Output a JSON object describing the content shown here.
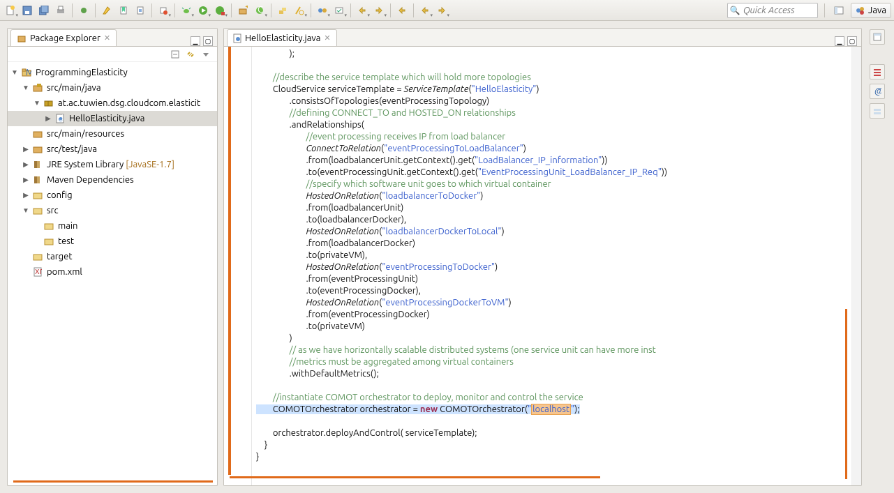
{
  "quick_access": {
    "placeholder": "Quick Access"
  },
  "perspective": {
    "label": "Java"
  },
  "explorer": {
    "title": "Package Explorer",
    "tree": {
      "project": "ProgrammingElasticity",
      "src_main_java": "src/main/java",
      "package": "at.ac.tuwien.dsg.cloudcom.elasticit",
      "file": "HelloElasticity.java",
      "src_main_resources": "src/main/resources",
      "src_test_java": "src/test/java",
      "jre_lib": "JRE System Library",
      "jre_ver": "[JavaSE-1.7]",
      "maven_deps": "Maven Dependencies",
      "config": "config",
      "src": "src",
      "main": "main",
      "test": "test",
      "target": "target",
      "pom": "pom.xml"
    }
  },
  "editor": {
    "tab_label": "HelloElasticity.java",
    "code": {
      "l1": "                );",
      "c1": "        //describe the service template which will hold more topologies",
      "l2a": "        CloudService serviceTemplate = ",
      "l2b": "ServiceTemplate",
      "l2c": "(",
      "l2s": "\"HelloElasticity\"",
      "l2d": ")",
      "l3": "                .consistsOfTopologies(eventProcessingTopology)",
      "c2": "                //defining CONNECT_TO and HOSTED_ON relationships",
      "l4": "                .andRelationships(",
      "c3": "                        //event processing receives IP from load balancer",
      "l5a": "                        ",
      "l5m": "ConnectToRelation",
      "l5b": "(",
      "l5s": "\"eventProcessingToLoadBalancer\"",
      "l5c": ")",
      "l6a": "                        .from(loadbalancerUnit.getContext().get(",
      "l6s": "\"LoadBalancer_IP_information\"",
      "l6b": "))",
      "l7a": "                        .to(eventProcessingUnit.getContext().get(",
      "l7s": "\"EventProcessingUnit_LoadBalancer_IP_Req\"",
      "l7b": "))",
      "c4": "                        //specify which software unit goes to which virtual container",
      "l8a": "                        ",
      "l8m": "HostedOnRelation",
      "l8b": "(",
      "l8s": "\"loadbalancerToDocker\"",
      "l8c": ")",
      "l9": "                        .from(loadbalancerUnit)",
      "l10": "                        .to(loadbalancerDocker),",
      "l11a": "                        ",
      "l11m": "HostedOnRelation",
      "l11b": "(",
      "l11s": "\"loadbalancerDockerToLocal\"",
      "l11c": ")",
      "l12": "                        .from(loadbalancerDocker)",
      "l13": "                        .to(privateVM),",
      "l14a": "                        ",
      "l14m": "HostedOnRelation",
      "l14b": "(",
      "l14s": "\"eventProcessingToDocker\"",
      "l14c": ")",
      "l15": "                        .from(eventProcessingUnit)",
      "l16": "                        .to(eventProcessingDocker),",
      "l17a": "                        ",
      "l17m": "HostedOnRelation",
      "l17b": "(",
      "l17s": "\"eventProcessingDockerToVM\"",
      "l17c": ")",
      "l18": "                        .from(eventProcessingDocker)",
      "l19": "                        .to(privateVM)",
      "l20": "                )",
      "c5": "                // as we have horizontally scalable distributed systems (one service unit can have more inst",
      "c6": "                //metrics must be aggregated among virtual containers",
      "l21": "                .withDefaultMetrics();",
      "c7": "        //instantiate COMOT orchestrator to deploy, monitor and control the service",
      "l22a": "        COMOTOrchestrator orchestrator = ",
      "l22k": "new",
      "l22b": " COMOTOrchestrator(",
      "l22s1": "\"",
      "l22sel": "localhost",
      "l22s2": "\"",
      "l22c": ");",
      "l23": "        orchestrator.deployAndControl( serviceTemplate);",
      "l24": "    }",
      "l25": "}"
    }
  }
}
